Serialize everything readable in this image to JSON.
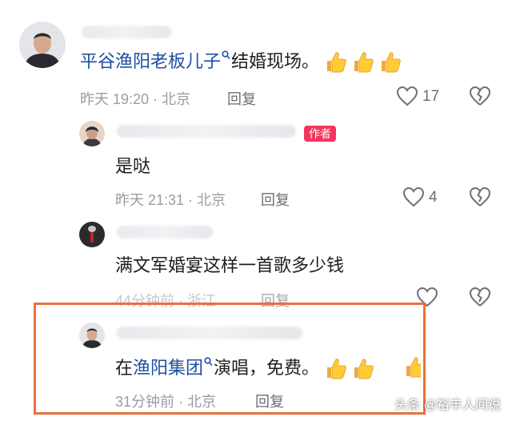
{
  "comments": [
    {
      "text_link": "平谷渔阳老板儿子",
      "text_rest": "结婚现场。",
      "time": "昨天 19:20 · 北京",
      "reply": "回复",
      "likes": "17"
    },
    {
      "badge": "作者",
      "text": "是哒",
      "time": "昨天 21:31 · 北京",
      "reply": "回复",
      "likes": "4"
    },
    {
      "text": "满文军婚宴这样一首歌多少钱",
      "time": "44分钟前 · 浙江",
      "reply": "回复"
    },
    {
      "text_prefix": "在",
      "text_link": "渔阳集团",
      "text_rest": "演唱，免费。",
      "time": "31分钟前 · 北京",
      "reply": "回复"
    }
  ],
  "watermark": "头条 @裕丰人间说",
  "colors": {
    "link": "#1d4fa3",
    "badge": "#f5355c",
    "highlight_border": "#ec6f3c"
  },
  "icons": [
    "search-icon",
    "thumbs-up-emoji",
    "heart-icon",
    "broken-heart-icon"
  ]
}
